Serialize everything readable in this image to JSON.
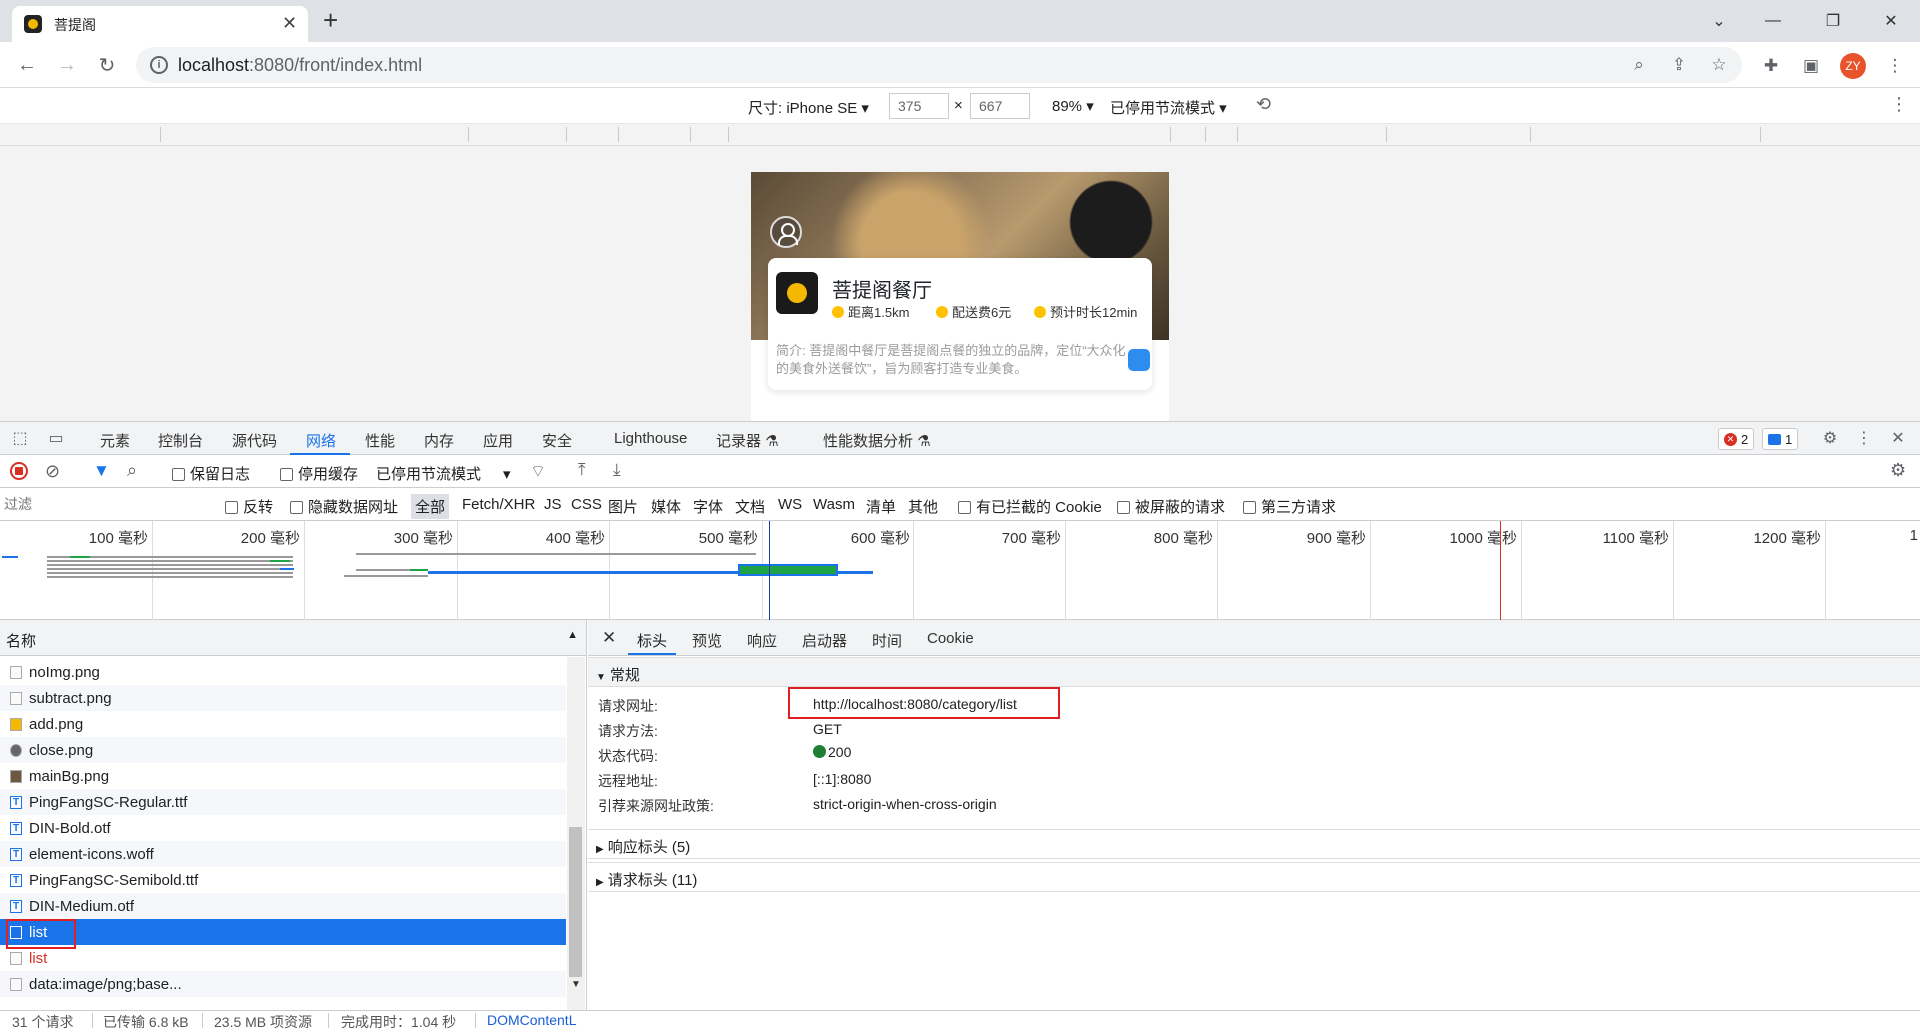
{
  "browser": {
    "tab_title": "菩提阁",
    "url_host": "localhost",
    "url_rest": ":8080/front/index.html",
    "avatar_initials": "ZY"
  },
  "device_toolbar": {
    "dimensions_label": "尺寸: iPhone SE",
    "width": "375",
    "times": "×",
    "height": "667",
    "zoom": "89%",
    "throttle": "已停用节流模式"
  },
  "restaurant": {
    "name": "菩提阁餐厅",
    "distance": "距离1.5km",
    "delivery_fee": "配送费6元",
    "eta": "预计时长12min",
    "intro": "简介: 菩提阁中餐厅是菩提阁点餐的独立的品牌，定位“大众化的美食外送餐饮”，旨为顾客打造专业美食。"
  },
  "devtools": {
    "tabs": [
      "元素",
      "控制台",
      "源代码",
      "网络",
      "性能",
      "内存",
      "应用",
      "安全",
      "Lighthouse",
      "记录器",
      "性能数据分析"
    ],
    "active_tab": "网络",
    "error_count": "2",
    "message_count": "1",
    "toolbar": {
      "preserve_log": "保留日志",
      "disable_cache": "停用缓存",
      "throttle": "已停用节流模式"
    },
    "filter": {
      "placeholder": "过滤",
      "invert": "反转",
      "hide_data_urls": "隐藏数据网址",
      "types": [
        "全部",
        "Fetch/XHR",
        "JS",
        "CSS",
        "图片",
        "媒体",
        "字体",
        "文档",
        "WS",
        "Wasm",
        "清单",
        "其他"
      ],
      "blocked_cookies": "有已拦截的 Cookie",
      "blocked_requests": "被屏蔽的请求",
      "third_party": "第三方请求"
    },
    "timeline_labels": [
      "100 毫秒",
      "200 毫秒",
      "300 毫秒",
      "400 毫秒",
      "500 毫秒",
      "600 毫秒",
      "700 毫秒",
      "800 毫秒",
      "900 毫秒",
      "1000 毫秒",
      "1100 毫秒",
      "1200 毫秒",
      "1"
    ],
    "request_list": {
      "header": "名称",
      "rows": [
        {
          "name": "noImg.png",
          "kind": "img"
        },
        {
          "name": "subtract.png",
          "kind": "img"
        },
        {
          "name": "add.png",
          "kind": "img"
        },
        {
          "name": "close.png",
          "kind": "img"
        },
        {
          "name": "mainBg.png",
          "kind": "img"
        },
        {
          "name": "PingFangSC-Regular.ttf",
          "kind": "font"
        },
        {
          "name": "DIN-Bold.otf",
          "kind": "font"
        },
        {
          "name": "element-icons.woff",
          "kind": "font"
        },
        {
          "name": "PingFangSC-Semibold.ttf",
          "kind": "font"
        },
        {
          "name": "DIN-Medium.otf",
          "kind": "font"
        },
        {
          "name": "list",
          "kind": "xhr",
          "selected": true
        },
        {
          "name": "list",
          "kind": "xhr",
          "error": true
        },
        {
          "name": "data:image/png;base...",
          "kind": "img"
        }
      ]
    },
    "detail": {
      "tabs": [
        "标头",
        "预览",
        "响应",
        "启动器",
        "时间",
        "Cookie"
      ],
      "general_title": "常规",
      "fields": [
        {
          "key": "请求网址:",
          "value": "http://localhost:8080/category/list"
        },
        {
          "key": "请求方法:",
          "value": "GET"
        },
        {
          "key": "状态代码:",
          "value": "200"
        },
        {
          "key": "远程地址:",
          "value": "[::1]:8080"
        },
        {
          "key": "引荐来源网址政策:",
          "value": "strict-origin-when-cross-origin"
        }
      ],
      "response_headers": "响应标头 (5)",
      "request_headers": "请求标头 (11)"
    },
    "status": {
      "requests": "31 个请求",
      "transferred": "已传输 6.8 kB",
      "resources": "23.5 MB 项资源",
      "finish": "完成用时：1.04 秒",
      "domcontent": "DOMContentL"
    }
  }
}
